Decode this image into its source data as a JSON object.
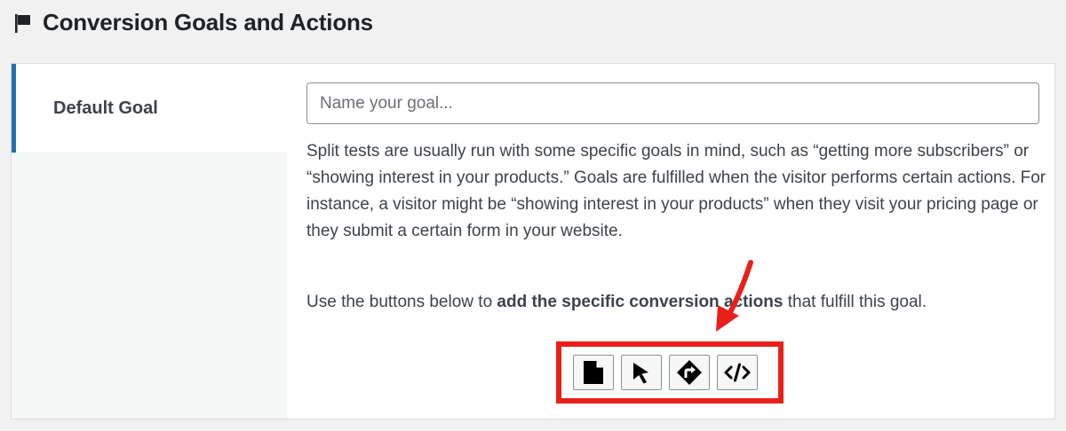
{
  "header": {
    "title": "Conversion Goals and Actions",
    "icon": "flag-icon"
  },
  "sidebar": {
    "tabs": [
      {
        "label": "Default Goal",
        "active": true
      }
    ]
  },
  "goal_editor": {
    "name_input": {
      "placeholder": "Name your goal...",
      "value": ""
    },
    "description": "Split tests are usually run with some specific goals in mind, such as “getting more subscribers” or “showing interest in your products.” Goals are fulfilled when the visitor performs certain actions. For instance, a visitor might be “showing interest in your products” when they visit your pricing page or they submit a certain form in your website.",
    "instruction": {
      "before": "Use the buttons below to ",
      "emphasis": "add the specific conversion actions",
      "after": " that fulfill this goal."
    },
    "action_buttons": [
      {
        "icon": "page-icon"
      },
      {
        "icon": "cursor-click-icon"
      },
      {
        "icon": "direction-sign-icon"
      },
      {
        "icon": "code-icon"
      }
    ]
  },
  "colors": {
    "accent": "#2271b1",
    "highlight": "#e8201a",
    "text": "#3c434a",
    "heading": "#1d2327",
    "background": "#f1f1f1"
  }
}
